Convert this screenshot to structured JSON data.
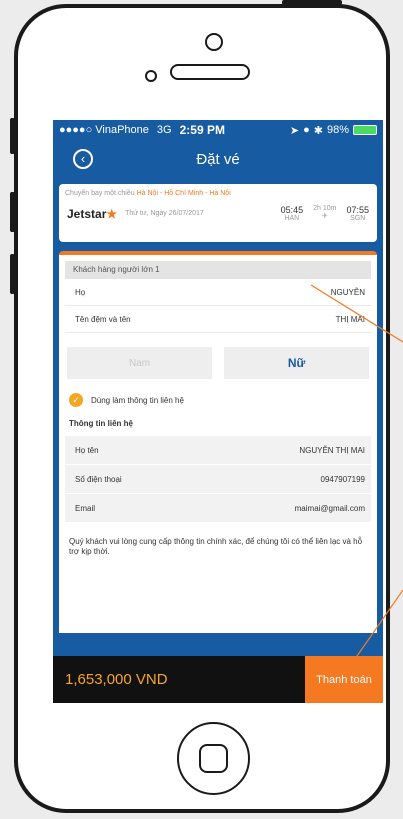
{
  "status_bar": {
    "carrier": "●●●●○ VinaPhone",
    "network": "3G",
    "time": "2:59 PM",
    "battery": "98%"
  },
  "nav": {
    "back_icon": "back-circle",
    "title": "Đặt vé"
  },
  "flight": {
    "prefix": "Chuyến bay một chiều",
    "route": "Hà Nội - Hồ Chí Minh - Hà Nội",
    "airline": "Jetstar",
    "date": "Thứ tư, Ngày 26/07/2017",
    "depart_time": "05:45",
    "depart_code": "HAN",
    "duration": "2h 10m",
    "arrive_time": "07:55",
    "arrive_code": "SGN"
  },
  "passenger": {
    "header": "Khách hàng người lớn 1",
    "last_name_label": "Họ",
    "last_name_value": "NGUYỄN",
    "first_name_label": "Tên đệm và tên",
    "first_name_value": "THỊ MAI",
    "gender_male": "Nam",
    "gender_female": "Nữ",
    "use_as_contact": "Dùng làm thông tin liên hệ"
  },
  "contact": {
    "section_title": "Thông tin liên hệ",
    "name_label": "Họ tên",
    "name_value": "NGUYỄN THỊ MAI",
    "phone_label": "Số điện thoại",
    "phone_value": "0947907199",
    "email_label": "Email",
    "email_value": "maimai@gmail.com",
    "note": "Quý khách vui lòng cung cấp thông tin chính xác, để chúng tôi có thể liên lạc và hỗ trợ kịp thời."
  },
  "footer": {
    "price": "1,653,000 VND",
    "pay_label": "Thanh toán"
  },
  "colors": {
    "brand_blue": "#175ba3",
    "accent_orange": "#f47920"
  }
}
